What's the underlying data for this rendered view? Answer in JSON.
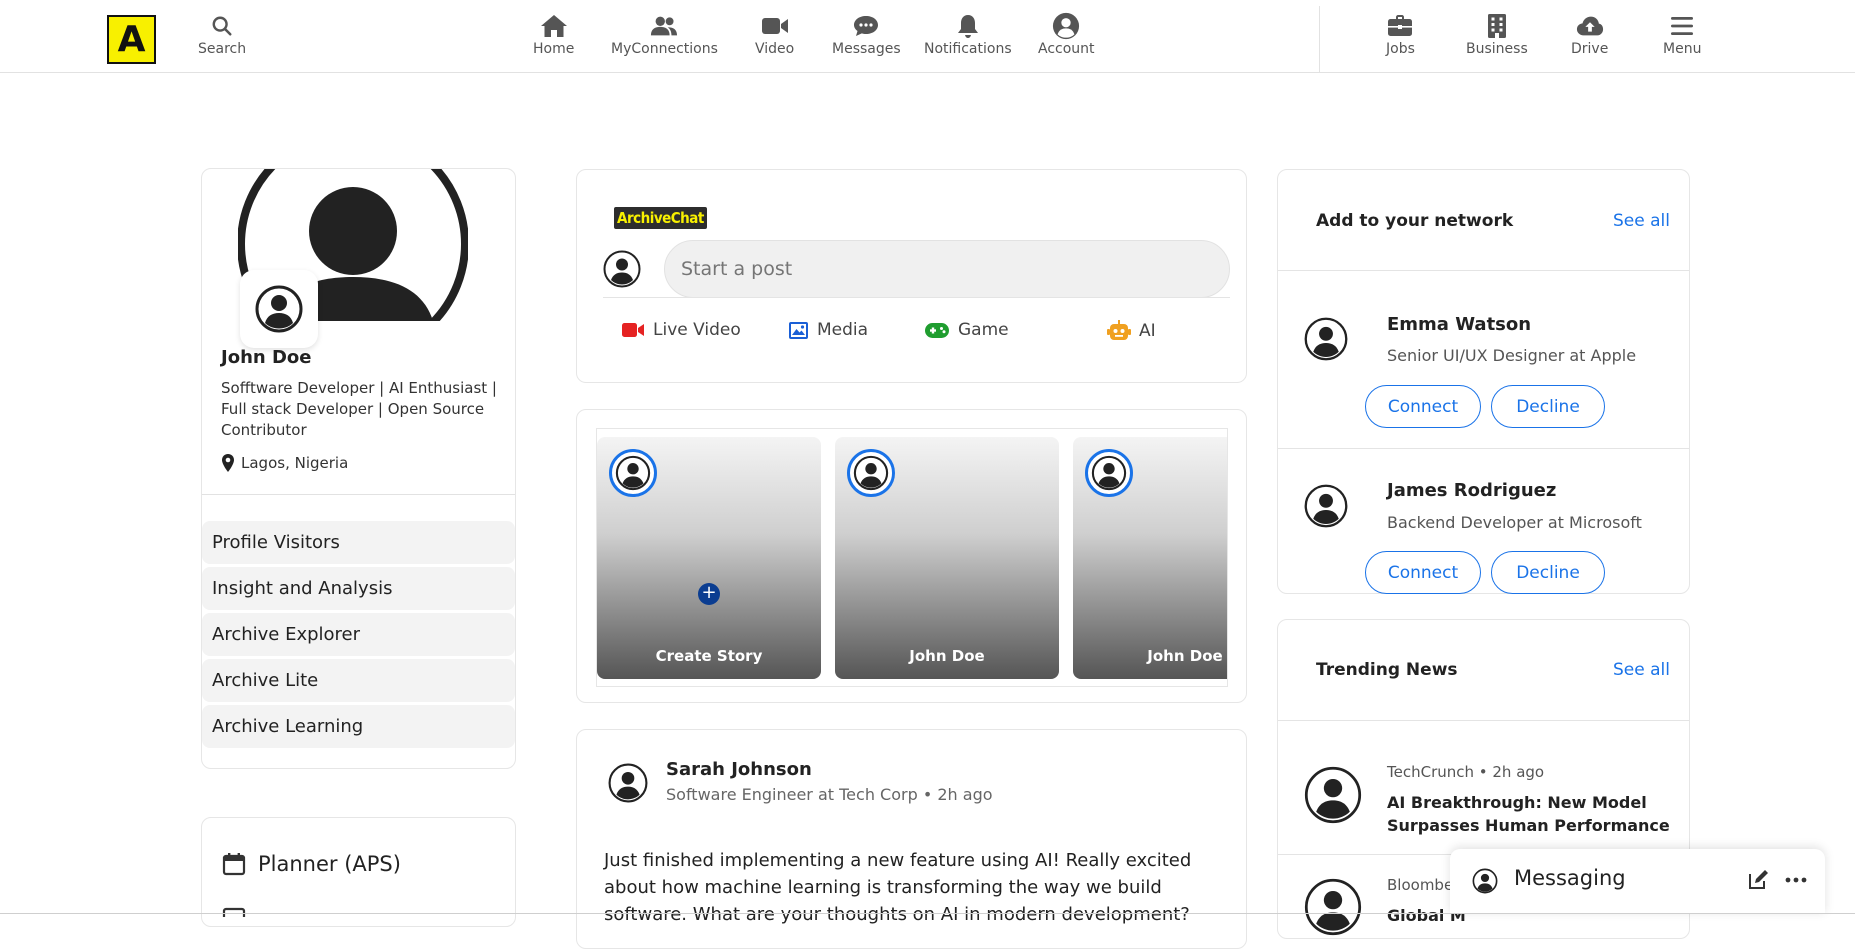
{
  "logo": {
    "letter": "A"
  },
  "nav": {
    "search": "Search",
    "items": [
      {
        "label": "Home",
        "icon": "home-icon"
      },
      {
        "label": "MyConnections",
        "icon": "people-icon"
      },
      {
        "label": "Video",
        "icon": "video-icon"
      },
      {
        "label": "Messages",
        "icon": "chat-icon"
      },
      {
        "label": "Notifications",
        "icon": "bell-icon"
      },
      {
        "label": "Account",
        "icon": "account-icon"
      }
    ],
    "right_items": [
      {
        "label": "Jobs",
        "icon": "briefcase-icon"
      },
      {
        "label": "Business",
        "icon": "building-icon"
      },
      {
        "label": "Drive",
        "icon": "cloud-upload-icon"
      },
      {
        "label": "Menu",
        "icon": "hamburger-icon"
      }
    ]
  },
  "profile": {
    "name": "John Doe",
    "bio": "Sofftware Developer | AI Enthusiast | Full stack Developer | Open Source Contributor",
    "location": "Lagos, Nigeria",
    "menu": [
      "Profile Visitors",
      "Insight and Analysis",
      "Archive Explorer",
      "Archive Lite",
      "Archive Learning"
    ]
  },
  "planner": {
    "label": "Planner (APS)"
  },
  "composer": {
    "brand": "ArchiveChat",
    "placeholder": "Start a post",
    "actions": [
      {
        "label": "Live Video",
        "icon": "live-video-icon",
        "color": "#e52222"
      },
      {
        "label": "Media",
        "icon": "image-icon",
        "color": "#1a5fd6"
      },
      {
        "label": "Game",
        "icon": "gamepad-icon",
        "color": "#1f9d2f"
      },
      {
        "label": "AI",
        "icon": "robot-icon",
        "color": "#f0a020"
      }
    ]
  },
  "stories": [
    {
      "label": "Create Story"
    },
    {
      "label": "John Doe"
    },
    {
      "label": "John Doe"
    }
  ],
  "post": {
    "author": "Sarah Johnson",
    "meta": "Software Engineer at Tech Corp • 2h ago",
    "text": "Just finished implementing a new feature using AI! Really excited about how machine learning is transforming the way we build software. What are your thoughts on AI in modern development?"
  },
  "network": {
    "title": "Add to your network",
    "see_all": "See all",
    "people": [
      {
        "name": "Emma Watson",
        "title": "Senior UI/UX Designer at Apple",
        "connect": "Connect",
        "decline": "Decline"
      },
      {
        "name": "James Rodriguez",
        "title": "Backend Developer at Microsoft",
        "connect": "Connect",
        "decline": "Decline"
      }
    ]
  },
  "news": {
    "title": "Trending News",
    "see_all": "See all",
    "items": [
      {
        "source": "TechCrunch • 2h ago",
        "headline": "AI Breakthrough: New Model Surpasses Human Performance"
      },
      {
        "source": "Bloomberg",
        "headline": "Global M"
      }
    ]
  },
  "messaging": {
    "label": "Messaging"
  },
  "colors": {
    "accent": "#1a73e8",
    "logo_bg": "#f8f000"
  }
}
